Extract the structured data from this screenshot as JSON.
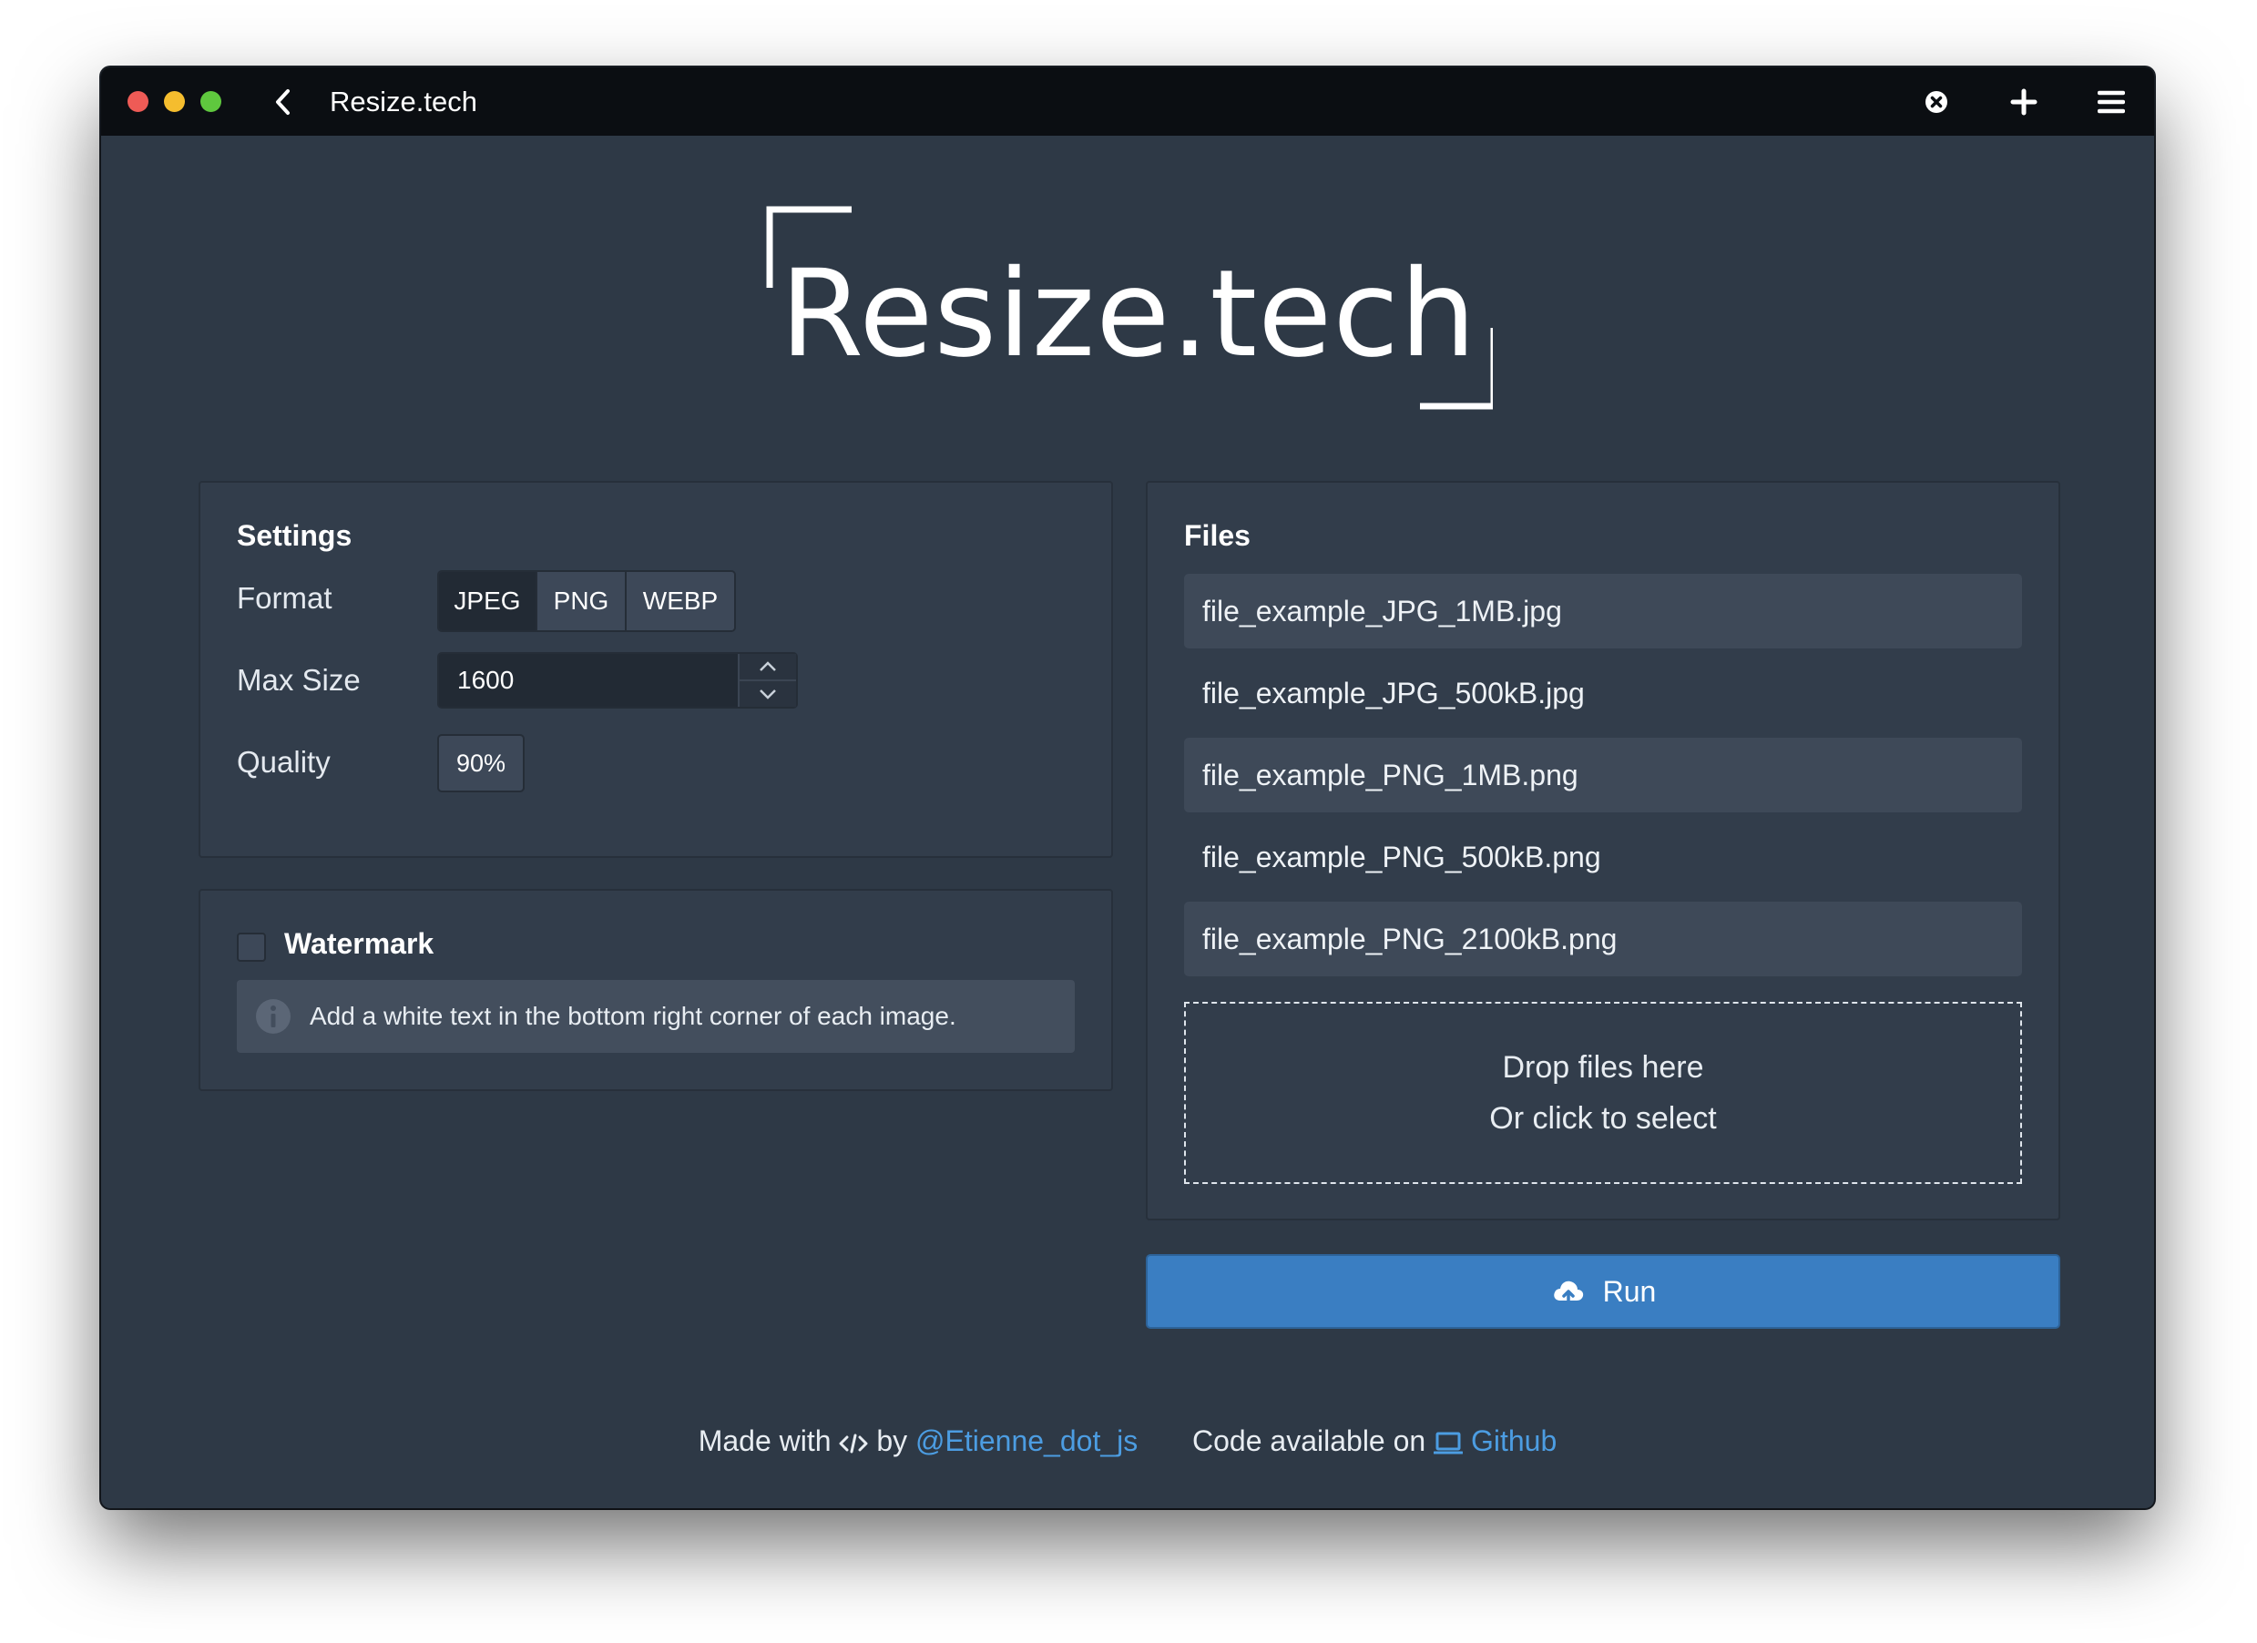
{
  "window": {
    "title": "Resize.tech"
  },
  "logo": {
    "text": "Resize.tech"
  },
  "settings": {
    "title": "Settings",
    "format_label": "Format",
    "format_options": [
      "JPEG",
      "PNG",
      "WEBP"
    ],
    "format_selected": "JPEG",
    "max_size_label": "Max Size",
    "max_size_value": "1600",
    "quality_label": "Quality",
    "quality_value": "90%"
  },
  "watermark": {
    "title": "Watermark",
    "checked": false,
    "info_text": "Add a white text in the bottom right corner of each image."
  },
  "files": {
    "title": "Files",
    "items": [
      "file_example_JPG_1MB.jpg",
      "file_example_JPG_500kB.jpg",
      "file_example_PNG_1MB.png",
      "file_example_PNG_500kB.png",
      "file_example_PNG_2100kB.png"
    ],
    "dropzone_line1": "Drop files here",
    "dropzone_line2": "Or click to select"
  },
  "run_button": {
    "label": "Run",
    "icon": "cloud-upload-icon"
  },
  "footer": {
    "made_with": "Made with",
    "code_icon": "code-icon",
    "by": "by",
    "author_link": "@Etienne_dot_js",
    "code_available": "Code available on",
    "github_icon": "laptop-icon",
    "github_link": "Github"
  },
  "colors": {
    "background": "#2e3946",
    "titlebar": "#0b0e12",
    "card": "#323d4b",
    "accent": "#3a7ec2",
    "link": "#4c9de2"
  }
}
